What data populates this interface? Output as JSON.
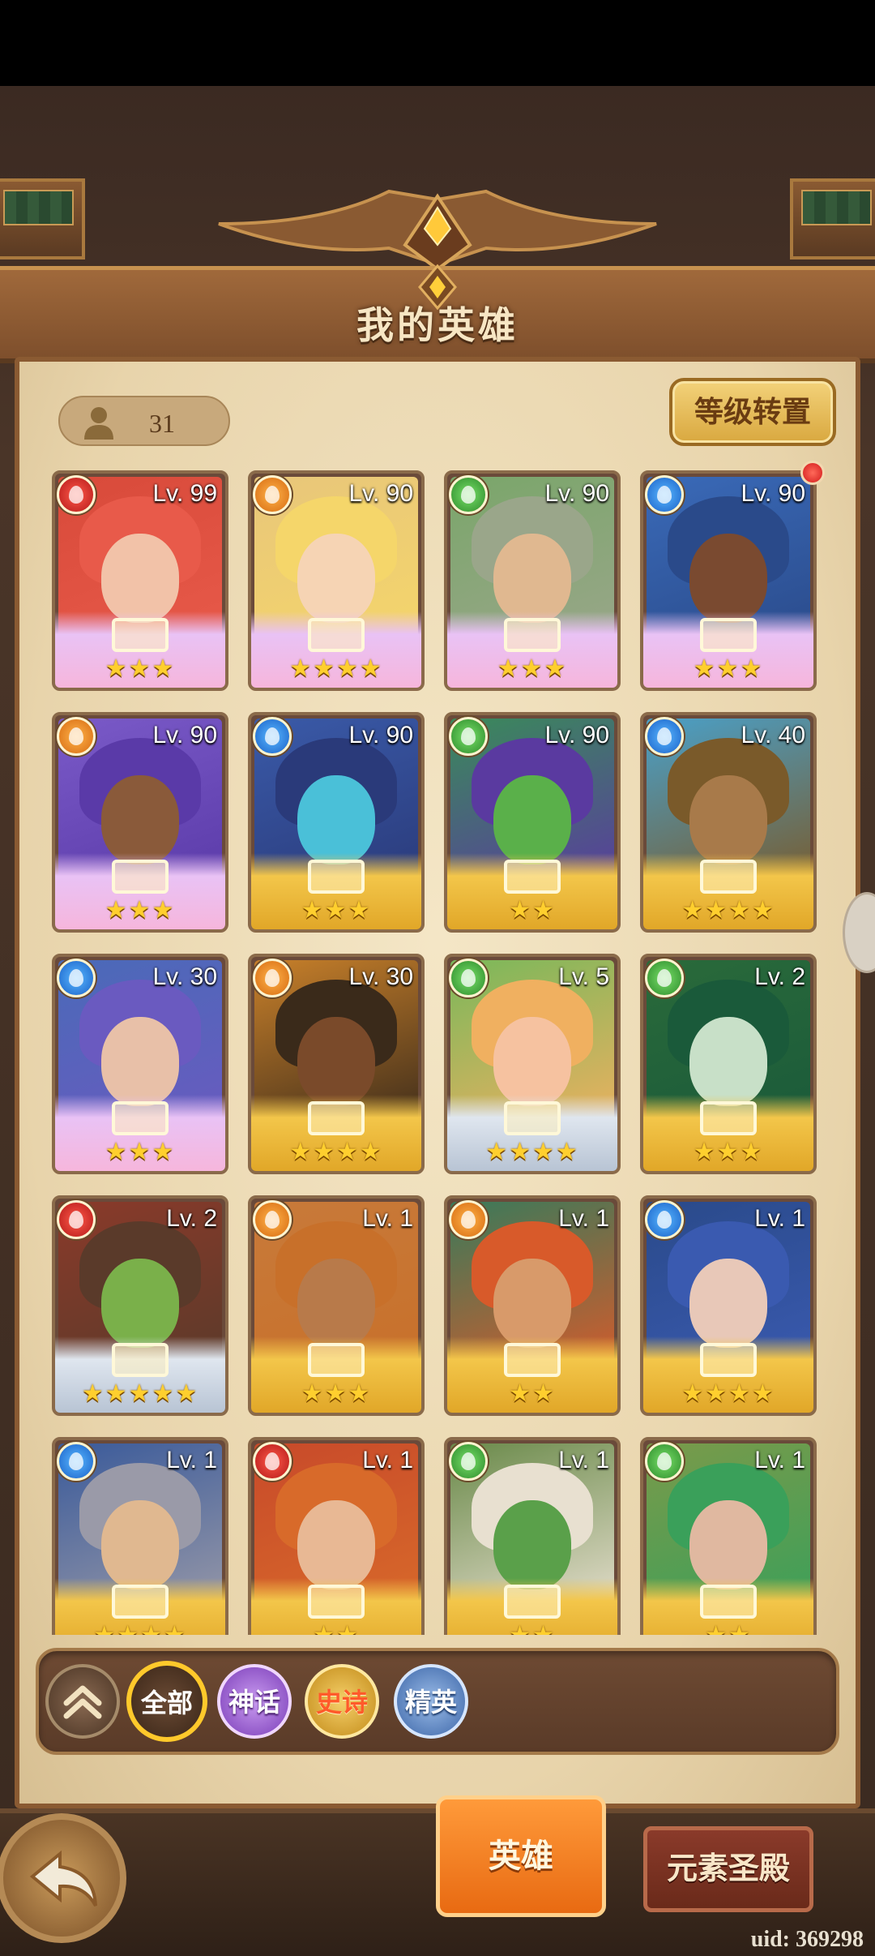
{
  "header": {
    "title": "我的英雄"
  },
  "hero_count": "31",
  "reset_button": "等级转置",
  "heroes": [
    {
      "lv": "Lv. 99",
      "element": "fire",
      "rarity": "myth",
      "stars": "★★★",
      "palette": [
        "#d84a3a",
        "#f2c2a8",
        "#e85a4a"
      ]
    },
    {
      "lv": "Lv. 90",
      "element": "earth",
      "rarity": "myth",
      "stars": "★★★★",
      "palette": [
        "#e8c67a",
        "#f6d4b4",
        "#f5d66a"
      ]
    },
    {
      "lv": "Lv. 90",
      "element": "nature",
      "rarity": "myth",
      "stars": "★★★",
      "palette": [
        "#7aa66a",
        "#e0b890",
        "#9aa68a"
      ]
    },
    {
      "lv": "Lv. 90",
      "element": "water",
      "rarity": "myth",
      "stars": "★★★",
      "palette": [
        "#3a6ab8",
        "#7a4a30",
        "#2a4a8a"
      ]
    },
    {
      "lv": "Lv. 90",
      "element": "earth",
      "rarity": "myth",
      "stars": "★★★",
      "palette": [
        "#7a5ac8",
        "#8a5a3a",
        "#5a3aa8"
      ]
    },
    {
      "lv": "Lv. 90",
      "element": "water",
      "rarity": "epic",
      "stars": "★★★",
      "palette": [
        "#3a5aa8",
        "#4ac0d8",
        "#2a3a7a"
      ]
    },
    {
      "lv": "Lv. 90",
      "element": "nature",
      "rarity": "epic",
      "stars": "★★",
      "palette": [
        "#3a8a5a",
        "#5ab04a",
        "#5a3aa0"
      ]
    },
    {
      "lv": "Lv. 40",
      "element": "water",
      "rarity": "epic",
      "stars": "★★★★",
      "palette": [
        "#4aa0c8",
        "#a87a4a",
        "#7a5a2a"
      ]
    },
    {
      "lv": "Lv. 30",
      "element": "water",
      "rarity": "myth",
      "stars": "★★★",
      "palette": [
        "#4a6ab8",
        "#e8c0a8",
        "#6a5ac0"
      ]
    },
    {
      "lv": "Lv. 30",
      "element": "earth",
      "rarity": "epic",
      "stars": "★★★★",
      "palette": [
        "#c8802a",
        "#7a4a2a",
        "#3a2a1a"
      ]
    },
    {
      "lv": "Lv. 5",
      "element": "nature",
      "rarity": "elite",
      "stars": "★★★★",
      "palette": [
        "#7ab85a",
        "#f6c2a0",
        "#f0b060"
      ]
    },
    {
      "lv": "Lv. 2",
      "element": "nature",
      "rarity": "epic",
      "stars": "★★★",
      "palette": [
        "#2a6a3a",
        "#c8e0c8",
        "#1a5a3a"
      ]
    },
    {
      "lv": "Lv. 2",
      "element": "fire",
      "rarity": "elite",
      "stars": "★★★★★",
      "palette": [
        "#8a3a2a",
        "#7ab04a",
        "#5a3a2a"
      ]
    },
    {
      "lv": "Lv. 1",
      "element": "earth",
      "rarity": "epic",
      "stars": "★★★",
      "palette": [
        "#c87a3a",
        "#b87a4a",
        "#c8702a"
      ]
    },
    {
      "lv": "Lv. 1",
      "element": "earth",
      "rarity": "epic",
      "stars": "★★",
      "palette": [
        "#3a7a5a",
        "#d89a6a",
        "#d85a2a"
      ]
    },
    {
      "lv": "Lv. 1",
      "element": "water",
      "rarity": "epic",
      "stars": "★★★★",
      "palette": [
        "#2a4a8a",
        "#e8c8b8",
        "#3a5ab0"
      ]
    },
    {
      "lv": "Lv. 1",
      "element": "water",
      "rarity": "epic",
      "stars": "★★★★",
      "palette": [
        "#3a5a9a",
        "#e0b890",
        "#9a9aa8"
      ]
    },
    {
      "lv": "Lv. 1",
      "element": "fire",
      "rarity": "epic",
      "stars": "★★",
      "palette": [
        "#c84a2a",
        "#e8b894",
        "#d86a2a"
      ]
    },
    {
      "lv": "Lv. 1",
      "element": "nature",
      "rarity": "epic",
      "stars": "★★",
      "palette": [
        "#6a8a4a",
        "#5aa04a",
        "#e8e0d0"
      ]
    },
    {
      "lv": "Lv. 1",
      "element": "nature",
      "rarity": "epic",
      "stars": "★★",
      "palette": [
        "#7a9a4a",
        "#e0b8a0",
        "#3aa05a"
      ]
    }
  ],
  "filters": {
    "all": "全部",
    "myth": "神话",
    "epic": "史诗",
    "elite": "精英"
  },
  "tabs": {
    "heroes": "英雄",
    "shrine": "元素圣殿"
  },
  "uid": "uid: 369298"
}
